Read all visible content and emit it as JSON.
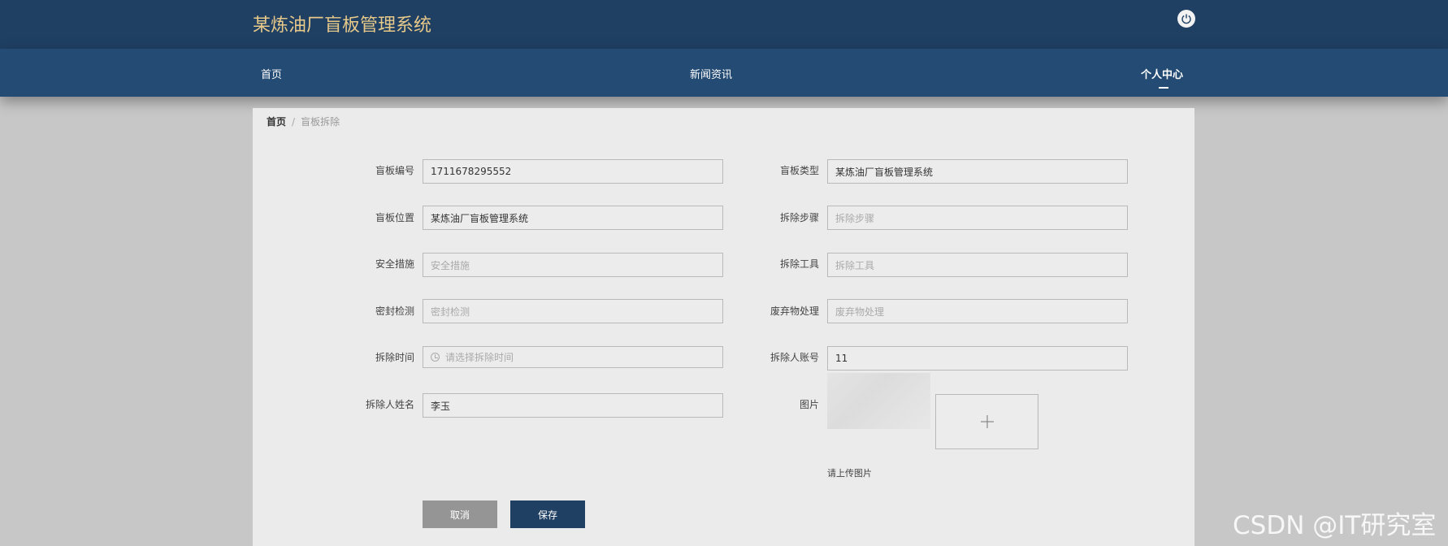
{
  "header": {
    "app_title": "某炼油厂盲板管理系统",
    "logout_icon": "power-icon"
  },
  "nav": {
    "items": [
      {
        "label": "首页"
      },
      {
        "label": "新闻资讯"
      },
      {
        "label": "个人中心",
        "active": true
      }
    ]
  },
  "breadcrumb": {
    "home": "首页",
    "separator": "/",
    "current": "盲板拆除"
  },
  "form": {
    "fields": [
      {
        "label": "盲板编号",
        "value": "1711678295552",
        "placeholder": ""
      },
      {
        "label": "盲板类型",
        "value": "某炼油厂盲板管理系统",
        "placeholder": ""
      },
      {
        "label": "盲板位置",
        "value": "某炼油厂盲板管理系统",
        "placeholder": ""
      },
      {
        "label": "拆除步骤",
        "value": "",
        "placeholder": "拆除步骤"
      },
      {
        "label": "安全措施",
        "value": "",
        "placeholder": "安全措施"
      },
      {
        "label": "拆除工具",
        "value": "",
        "placeholder": "拆除工具"
      },
      {
        "label": "密封检测",
        "value": "",
        "placeholder": "密封检测"
      },
      {
        "label": "废弃物处理",
        "value": "",
        "placeholder": "废弃物处理"
      },
      {
        "label": "拆除时间",
        "value": "",
        "placeholder": "请选择拆除时间",
        "icon": "clock-icon"
      },
      {
        "label": "拆除人账号",
        "value": "11",
        "placeholder": ""
      },
      {
        "label": "拆除人姓名",
        "value": "李玉",
        "placeholder": ""
      }
    ],
    "image": {
      "label": "图片",
      "upload_icon": "plus-icon",
      "hint": "请上传图片"
    },
    "buttons": {
      "cancel": "取消",
      "save": "保存"
    }
  },
  "watermark": "CSDN @IT研究室",
  "colors": {
    "header_bg": "#1f3f63",
    "nav_bg": "#244b73",
    "title_gold": "#e7c98a",
    "save_button": "#1f3f63",
    "cancel_button": "#959595"
  }
}
